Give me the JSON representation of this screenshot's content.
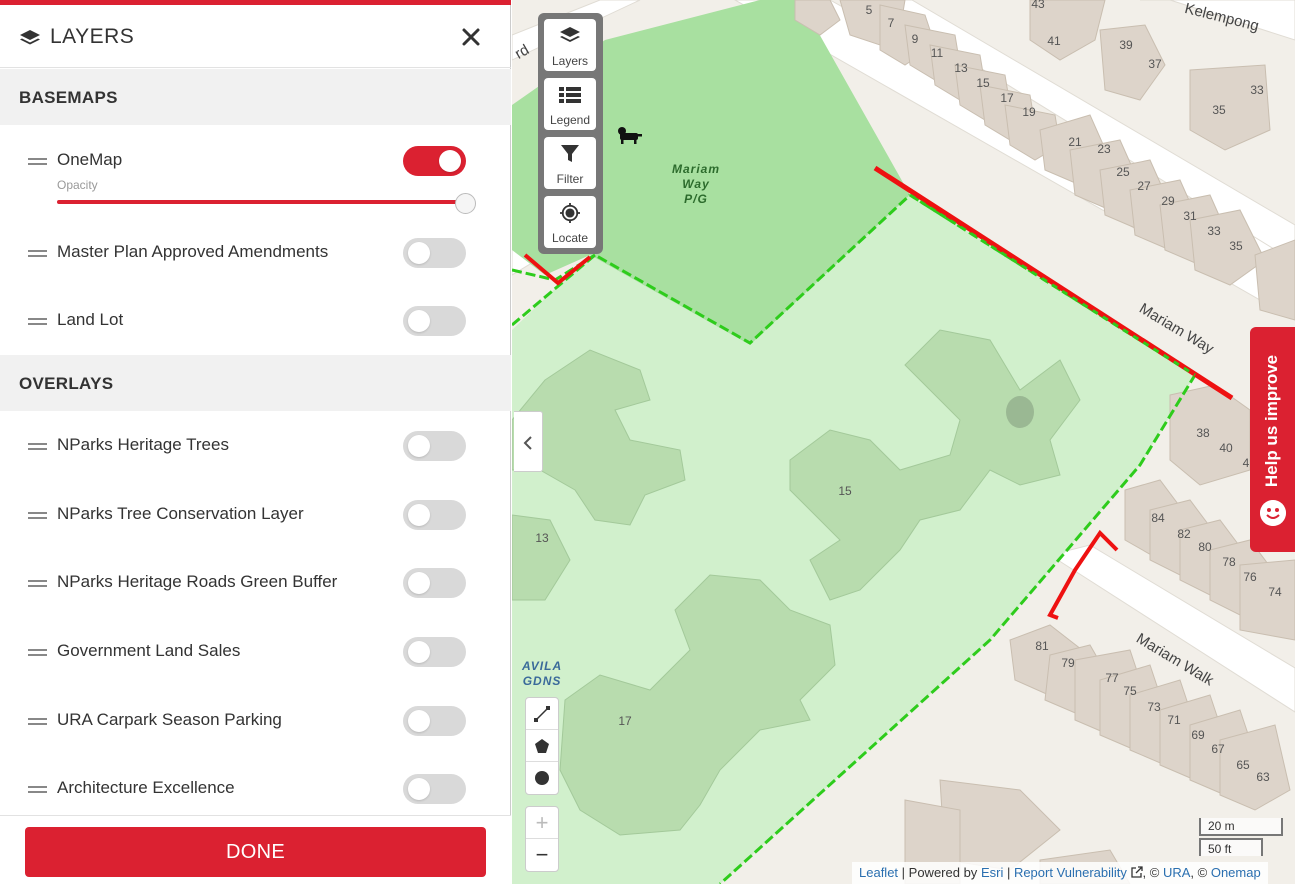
{
  "panel": {
    "title": "LAYERS",
    "basemaps_heading": "BASEMAPS",
    "overlays_heading": "OVERLAYS",
    "basemaps": [
      {
        "label": "OneMap",
        "on": true,
        "opacity_label": "Opacity",
        "opacity": 1.0
      },
      {
        "label": "Master Plan Approved Amendments",
        "on": false
      },
      {
        "label": "Land Lot",
        "on": false
      }
    ],
    "overlays": [
      {
        "label": "NParks Heritage Trees",
        "on": false
      },
      {
        "label": "NParks Tree Conservation Layer",
        "on": false
      },
      {
        "label": "NParks Heritage Roads Green Buffer",
        "on": false
      },
      {
        "label": "Government Land Sales",
        "on": false
      },
      {
        "label": "URA Carpark Season Parking",
        "on": false
      },
      {
        "label": "Architecture Excellence",
        "on": false
      }
    ],
    "done_label": "DONE"
  },
  "map_tools": {
    "layers": "Layers",
    "legend": "Legend",
    "filter": "Filter",
    "locate": "Locate"
  },
  "zoom": {
    "in": "+",
    "out": "−"
  },
  "help_tab": "Help us improve",
  "scale": {
    "metric": "20 m",
    "imperial": "50 ft"
  },
  "attribution": {
    "leaflet": "Leaflet",
    "powered_by": "Powered by",
    "esri": "Esri",
    "report": "Report Vulnerability",
    "ura": "URA",
    "onemap": "Onemap",
    "sep1": " | ",
    "sep2": " | ",
    "sep3": ", © ",
    "sep4": ", © "
  },
  "map_labels": {
    "streets": {
      "mariam_way": "Mariam Way",
      "mariam_walk": "Mariam Walk",
      "kelempong": "Kelempong",
      "rd_fragment": "rd"
    },
    "places": {
      "mariam_pg": [
        "Mariam",
        "Way",
        "P/G"
      ],
      "avila": [
        "AVILA",
        "GDNS"
      ]
    },
    "house_numbers": [
      "5",
      "7",
      "9",
      "11",
      "13",
      "15",
      "17",
      "19",
      "43",
      "41",
      "39",
      "37",
      "35",
      "33",
      "21",
      "23",
      "25",
      "27",
      "29",
      "31",
      "33",
      "35",
      "38",
      "40",
      "4",
      "84",
      "82",
      "80",
      "78",
      "76",
      "74",
      "81",
      "79",
      "77",
      "75",
      "73",
      "71",
      "69",
      "67",
      "65",
      "63"
    ],
    "block_numbers": [
      "13",
      "15",
      "17"
    ]
  },
  "colors": {
    "accent": "#db2131",
    "park_dark": "#a8e0a0",
    "park_light": "#d1f0cc",
    "boundary_green": "#2ecc1c",
    "boundary_red": "#ee1111",
    "building": "#ddd4ca",
    "building_green": "#b8dcae"
  }
}
